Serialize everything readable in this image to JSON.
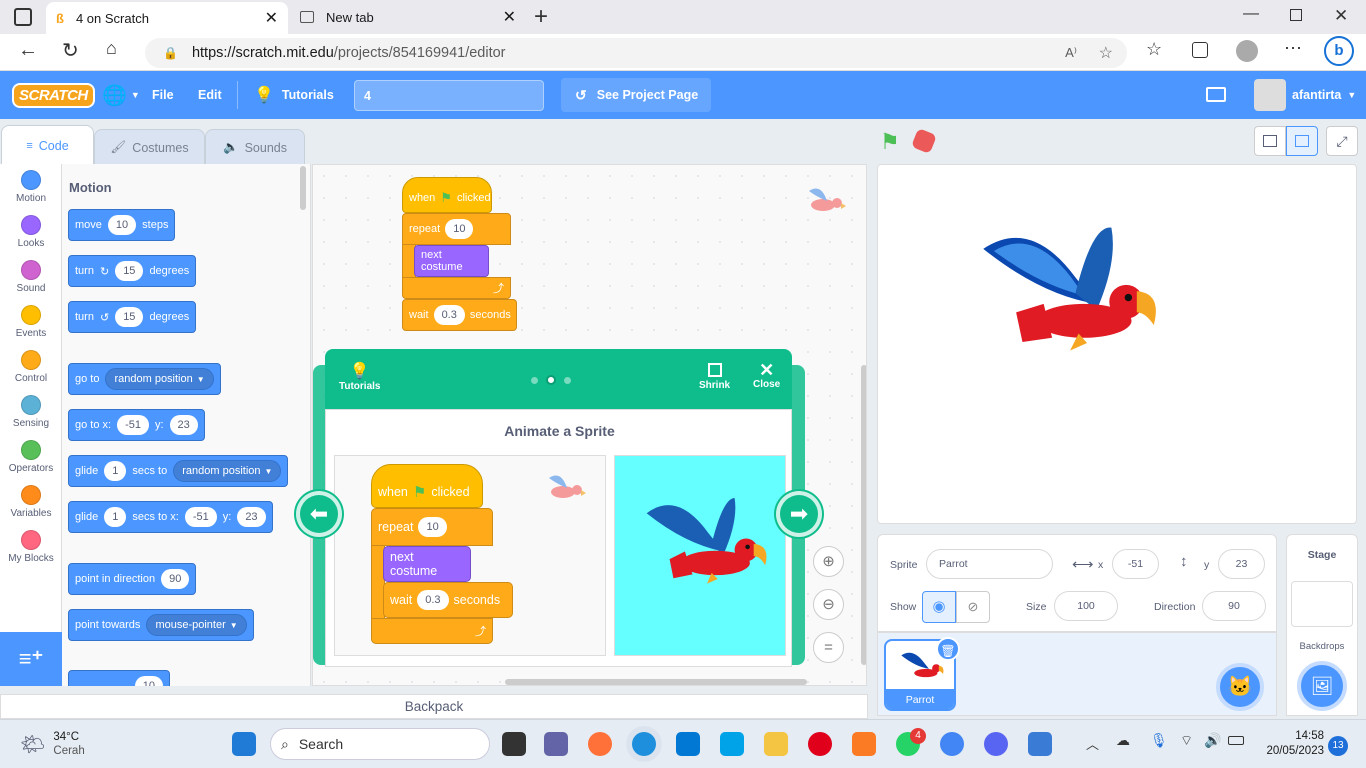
{
  "browser": {
    "tabs": [
      {
        "title": "4 on Scratch",
        "active": true
      },
      {
        "title": "New tab",
        "active": false
      }
    ],
    "url_host": "https://scratch.mit.edu",
    "url_path": "/projects/854169941/editor"
  },
  "menu": {
    "logo": "SCRATCH",
    "file": "File",
    "edit": "Edit",
    "tutorials": "Tutorials",
    "project_title": "4",
    "see_project_page": "See Project Page",
    "username": "afantirta"
  },
  "editor_tabs": {
    "code": "Code",
    "costumes": "Costumes",
    "sounds": "Sounds"
  },
  "categories": [
    {
      "label": "Motion",
      "color": "#4c97ff"
    },
    {
      "label": "Looks",
      "color": "#9966ff"
    },
    {
      "label": "Sound",
      "color": "#cf63cf"
    },
    {
      "label": "Events",
      "color": "#ffbf00"
    },
    {
      "label": "Control",
      "color": "#ffab19"
    },
    {
      "label": "Sensing",
      "color": "#5cb1d6"
    },
    {
      "label": "Operators",
      "color": "#59c059"
    },
    {
      "label": "Variables",
      "color": "#ff8c1a"
    },
    {
      "label": "My Blocks",
      "color": "#ff6680"
    }
  ],
  "palette": {
    "heading": "Motion",
    "move": {
      "a": "move",
      "n": "10",
      "b": "steps"
    },
    "turn_right": {
      "a": "turn",
      "n": "15",
      "b": "degrees"
    },
    "turn_left": {
      "a": "turn",
      "n": "15",
      "b": "degrees"
    },
    "goto": {
      "a": "go to",
      "opt": "random position"
    },
    "gotoxy": {
      "a": "go to x:",
      "x": "-51",
      "b": "y:",
      "y": "23"
    },
    "glide1": {
      "a": "glide",
      "n": "1",
      "b": "secs to",
      "opt": "random position"
    },
    "glide2": {
      "a": "glide",
      "n": "1",
      "b": "secs to x:",
      "x": "-51",
      "c": "y:",
      "y": "23"
    },
    "point_dir": {
      "a": "point in direction",
      "n": "90"
    },
    "point_towards": {
      "a": "point towards",
      "opt": "mouse-pointer"
    },
    "partial_value": "10"
  },
  "script": {
    "when": "when",
    "clicked": "clicked",
    "repeat": "repeat",
    "repeat_n": "10",
    "next_costume": "next costume",
    "wait": "wait",
    "wait_n": "0.3",
    "seconds": "seconds"
  },
  "tutorial": {
    "tutorials_label": "Tutorials",
    "shrink": "Shrink",
    "close": "Close",
    "title": "Animate a Sprite",
    "step_total": 3,
    "step_current": 2,
    "preview_bg": "#66ffff"
  },
  "sprite_info": {
    "sprite_label": "Sprite",
    "sprite_name": "Parrot",
    "x_label": "x",
    "x": "-51",
    "y_label": "y",
    "y": "23",
    "show_label": "Show",
    "size_label": "Size",
    "size": "100",
    "direction_label": "Direction",
    "direction": "90"
  },
  "sprite_list": [
    {
      "name": "Parrot"
    }
  ],
  "stage_panel": {
    "title": "Stage",
    "backdrops": "Backdrops"
  },
  "backpack": "Backpack",
  "taskbar": {
    "temp": "34°C",
    "weather": "Cerah",
    "search": "Search",
    "whatsapp_badge": "4",
    "time": "14:58",
    "date": "20/05/2023",
    "notif_count": "13"
  }
}
